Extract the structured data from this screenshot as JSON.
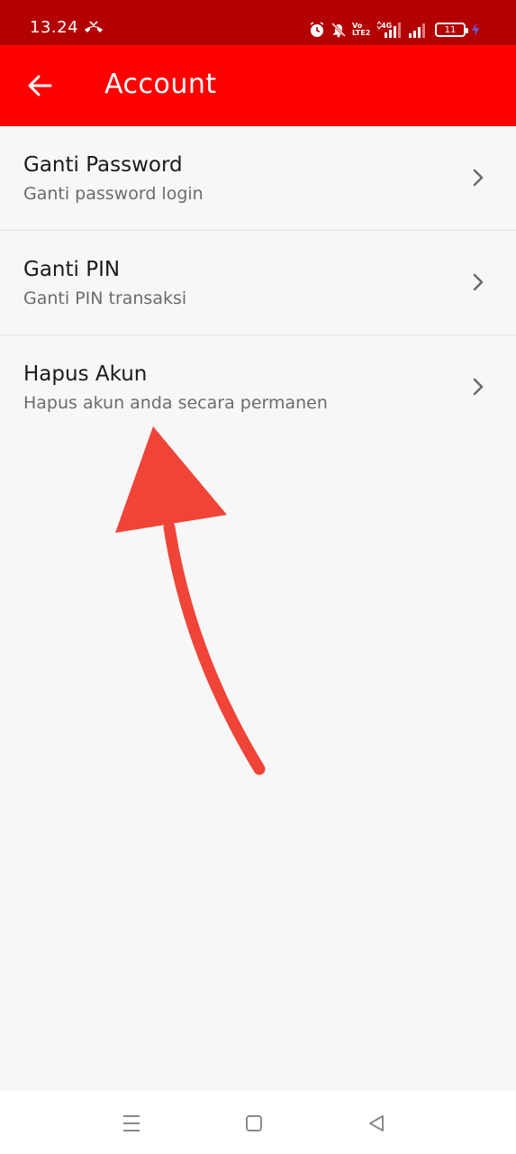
{
  "status_bar": {
    "time": "13.24",
    "volte_label": "Vo LTE2",
    "network_label": "4G",
    "battery_level": "11",
    "icons": [
      "missed-call-icon",
      "alarm-icon",
      "bell-muted-icon",
      "volte-icon",
      "signal-4g-icon",
      "signal-icon",
      "battery-icon",
      "charging-icon"
    ]
  },
  "app_bar": {
    "title": "Account",
    "back_icon": "arrow-left-icon",
    "color": "#ff0000"
  },
  "menu": {
    "items": [
      {
        "title": "Ganti Password",
        "subtitle": "Ganti password login"
      },
      {
        "title": "Ganti PIN",
        "subtitle": "Ganti PIN transaksi"
      },
      {
        "title": "Hapus Akun",
        "subtitle": "Hapus akun anda secara permanen"
      }
    ]
  },
  "annotation": {
    "type": "arrow",
    "color": "#f04438"
  },
  "nav_bar": {
    "icons": [
      "menu-icon",
      "home-square-icon",
      "back-triangle-icon"
    ]
  }
}
